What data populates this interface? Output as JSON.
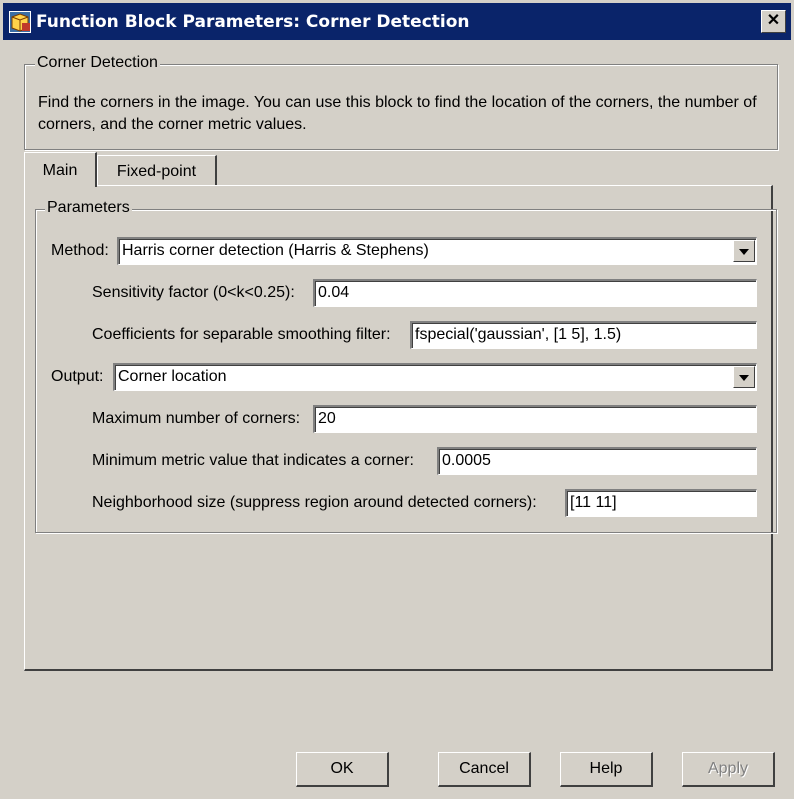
{
  "window": {
    "title": "Function Block Parameters: Corner Detection",
    "close_glyph": "✕",
    "icon": "simulink-block-icon"
  },
  "description_group": {
    "legend": "Corner Detection",
    "text": "Find the corners in the image. You can use this block to find the location of the corners, the number of corners, and the corner metric values."
  },
  "tabs": [
    {
      "label": "Main",
      "selected": true
    },
    {
      "label": "Fixed-point",
      "selected": false
    }
  ],
  "parameters": {
    "legend": "Parameters",
    "method": {
      "label": "Method:",
      "value": "Harris corner detection (Harris & Stephens)"
    },
    "sensitivity": {
      "label": "Sensitivity factor (0<k<0.25):",
      "value": "0.04"
    },
    "coefficients": {
      "label": "Coefficients for separable smoothing filter:",
      "value": "fspecial('gaussian', [1 5], 1.5)"
    },
    "output": {
      "label": "Output:",
      "value": "Corner location"
    },
    "max_corners": {
      "label": "Maximum number of corners:",
      "value": "20"
    },
    "min_metric": {
      "label": "Minimum metric value that indicates a corner:",
      "value": "0.0005"
    },
    "neighborhood": {
      "label": "Neighborhood size (suppress region around detected corners):",
      "value": "[11 11]"
    }
  },
  "buttons": {
    "ok": "OK",
    "cancel": "Cancel",
    "help": "Help",
    "apply": "Apply",
    "apply_enabled": false
  },
  "colors": {
    "titlebar": "#0a246a",
    "face": "#d4d0c8",
    "field": "#ffffff"
  }
}
